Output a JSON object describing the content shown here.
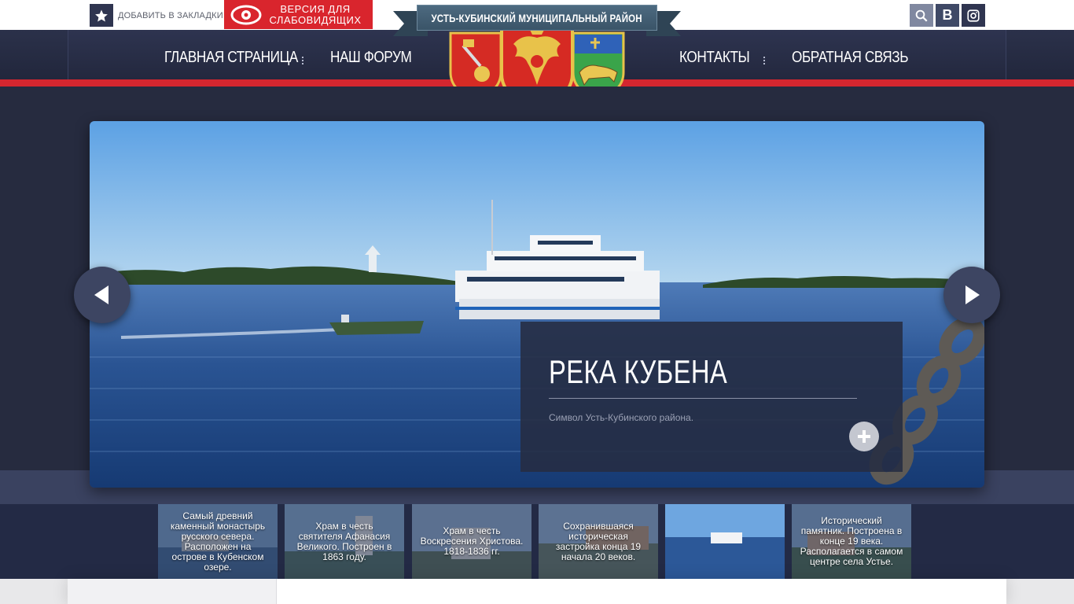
{
  "topbar": {
    "bookmark_label": "ДОБАВИТЬ В ЗАКЛАДКИ",
    "impaired_line1": "ВЕРСИЯ ДЛЯ",
    "impaired_line2": "СЛАБОВИДЯЩИХ",
    "vk_label": "B"
  },
  "header": {
    "ribbon_title": "УСТЬ-КУБИНСКИЙ МУНИЦИПАЛЬНЫЙ РАЙОН"
  },
  "nav": {
    "items": [
      {
        "label": "ГЛАВНАЯ СТРАНИЦА"
      },
      {
        "label": "НАШ ФОРУМ"
      },
      {
        "label": "КОНТАКТЫ"
      },
      {
        "label": "ОБРАТНАЯ СВЯЗЬ"
      }
    ]
  },
  "slide": {
    "title": "РЕКА КУБЕНА",
    "subtitle": "Символ Усть-Кубинского района."
  },
  "thumbnails": [
    {
      "text": "Самый древний каменный монастырь русского севера. Расположен на острове в Кубенском озере."
    },
    {
      "text": "Храм в честь святителя Афанасия Великого. Построен в 1863 году."
    },
    {
      "text": "Храм в честь Воскресения Христова. 1818-1836 гг."
    },
    {
      "text": "Сохранившаяся историческая застройка конца 19 начала 20 веков."
    },
    {
      "text": ""
    },
    {
      "text": "Исторический памятник. Построена в конце 19 века. Располагается в самом центре села Устье."
    }
  ],
  "colors": {
    "navy": "#262b3f",
    "red": "#d4262f",
    "ribbon": "#4d6a80"
  }
}
